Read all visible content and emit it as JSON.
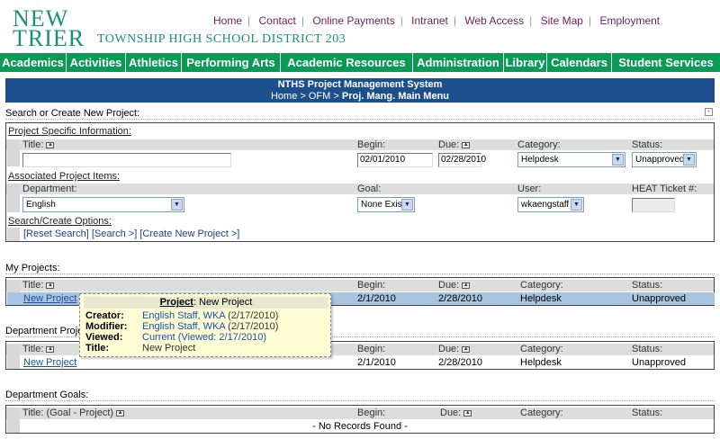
{
  "logo": {
    "line1": "NEW",
    "line2": "TRIER",
    "subtitle": "TOWNSHIP HIGH SCHOOL DISTRICT 203"
  },
  "top_links": [
    "Home",
    "Contact",
    "Online Payments",
    "Intranet",
    "Web Access",
    "Site Map",
    "Employment"
  ],
  "nav": [
    "Academics",
    "Activities",
    "Athletics",
    "Performing Arts",
    "Academic Resources",
    "Administration",
    "Library",
    "Calendars",
    "Student Services"
  ],
  "header": {
    "title": "NTHS Project Management System",
    "crumb_home": "Home",
    "crumb_ofm": "OFM",
    "crumb_current": "Proj. Mang. Main Menu",
    "crumb_sep": " > "
  },
  "search": {
    "section_title": "Search or Create New Project:",
    "collapse_symbol": "-",
    "project_info_label": "Project Specific Information:",
    "col_title": "Title:",
    "col_begin": "Begin:",
    "col_due": "Due:",
    "col_category": "Category:",
    "col_status": "Status:",
    "title_value": "",
    "begin_value": "02/01/2010",
    "due_value": "02/28/2010",
    "category_value": "Helpdesk",
    "status_value": "Unapproved",
    "assoc_label": "Associated Project Items:",
    "col_department": "Department:",
    "col_goal": "Goal:",
    "col_user": "User:",
    "col_heat": "HEAT Ticket #:",
    "department_value": "English",
    "goal_value": "None Exist",
    "user_value": "wkaengstaff",
    "heat_value": "",
    "options_label": "Search/Create Options:",
    "actions": [
      "[Reset Search]",
      "[Search >]",
      "[Create New Project >]"
    ]
  },
  "my_projects": {
    "label": "My Projects:",
    "col_title": "Title:",
    "col_begin": "Begin:",
    "col_due": "Due:",
    "col_category": "Category:",
    "col_status": "Status:",
    "rows": [
      {
        "title": "New Project",
        "begin": "2/1/2010",
        "due": "2/28/2010",
        "category": "Helpdesk",
        "status": "Unapproved"
      }
    ]
  },
  "dept_projects": {
    "label": "Department Proje",
    "col_title": "Title:",
    "col_begin": "Begin:",
    "col_due": "Due:",
    "col_category": "Category:",
    "col_status": "Status:",
    "rows": [
      {
        "title": "New Project",
        "begin": "2/1/2010",
        "due": "2/28/2010",
        "category": "Helpdesk",
        "status": "Unapproved"
      }
    ]
  },
  "dept_goals": {
    "label": "Department Goals:",
    "col_title": "Title: (Goal - Project)",
    "col_begin": "Begin:",
    "col_due": "Due:",
    "col_category": "Category:",
    "col_status": "Status:",
    "empty": "- No Records Found -"
  },
  "tooltip": {
    "title_key": "Project",
    "title_val": ": New Project",
    "creator_k": "Creator:",
    "creator_v": "English Staff, WKA",
    "creator_d": " (2/17/2010)",
    "modifier_k": "Modifier:",
    "modifier_v": "English Staff, WKA",
    "modifier_d": " (2/17/2010)",
    "viewed_k": "Viewed:",
    "viewed_v": "Current (Viewed: 2/17/2010)",
    "title_k": "Title:",
    "title_v": "New Project"
  },
  "icons": {
    "sort": "sort-icon",
    "dropdown": "dropdown-arrow-icon"
  },
  "colors": {
    "nav_green": "#0a9a55",
    "title_blue": "#1c4f8c",
    "logo_teal": "#1a8f7a",
    "row_highlight": "#a8c4e0",
    "tooltip_bg": "#fffdd6"
  }
}
